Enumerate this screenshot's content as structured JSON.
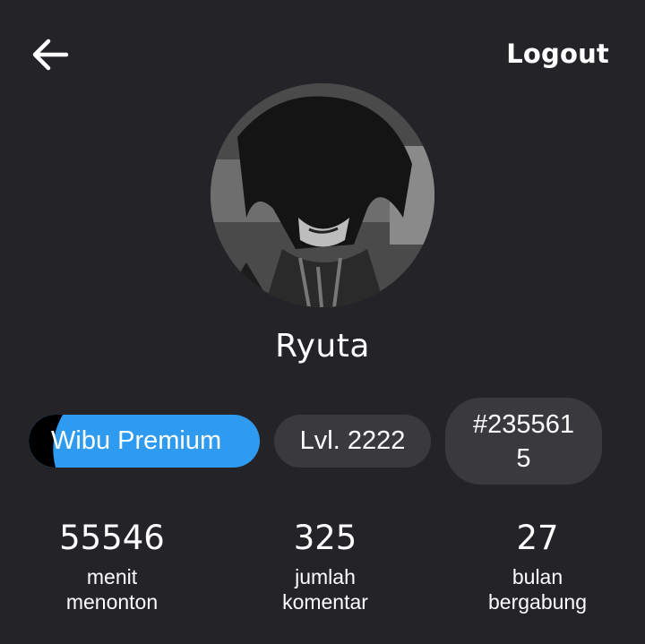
{
  "header": {
    "back_icon": "arrow-left-icon",
    "logout_label": "Logout"
  },
  "profile": {
    "avatar_icon": "user-avatar",
    "username": "Ryuta"
  },
  "badges": {
    "premium_label": "Wibu Premium",
    "level_label": "Lvl. 2222",
    "id_label": "#2355615"
  },
  "stats": [
    {
      "value": "55546",
      "label": "menit menonton"
    },
    {
      "value": "325",
      "label": "jumlah komentar"
    },
    {
      "value": "27",
      "label": "bulan bergabung"
    }
  ],
  "colors": {
    "background": "#242428",
    "premium_blue": "#2f9bf0",
    "badge_gray": "#3a3a3e"
  }
}
